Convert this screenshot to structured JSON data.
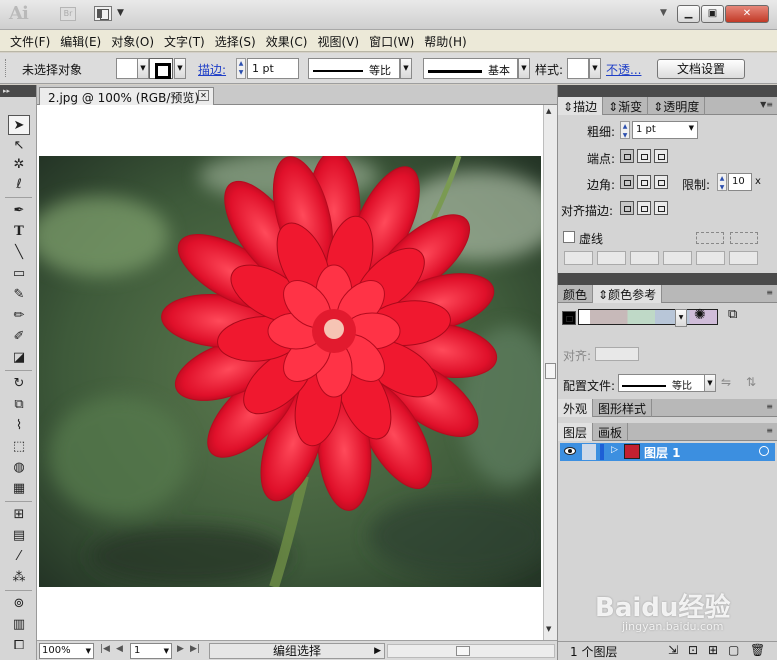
{
  "app": {
    "logo": "Ai",
    "bridge_label": "Br"
  },
  "menubar": [
    "文件(F)",
    "编辑(E)",
    "对象(O)",
    "文字(T)",
    "选择(S)",
    "效果(C)",
    "视图(V)",
    "窗口(W)",
    "帮助(H)"
  ],
  "controlbar": {
    "selection_status": "未选择对象",
    "stroke_label": "描边:",
    "stroke_weight": "1 pt",
    "stroke_profile": "等比",
    "brush": "基本",
    "style_label": "样式:",
    "opacity_link": "不透...",
    "doc_settings": "文档设置"
  },
  "document": {
    "tab_title": "2.jpg @ 100% (RGB/预览)",
    "zoom": "100%",
    "page": "1",
    "status": "编组选择"
  },
  "stroke_panel": {
    "tabs": [
      "描边",
      "渐变",
      "透明度"
    ],
    "weight_label": "粗细:",
    "weight_value": "1 pt",
    "cap_label": "端点:",
    "corner_label": "边角:",
    "limit_label": "限制:",
    "limit_value": "10",
    "limit_unit": "x",
    "align_label": "对齐描边:",
    "dashed_label": "虚线"
  },
  "color_panel": {
    "tabs": [
      "颜色",
      "颜色参考"
    ],
    "align_label": "对齐:",
    "profile_label": "配置文件:",
    "profile_value": "等比"
  },
  "appearance_panel": {
    "tabs": [
      "外观",
      "图形样式"
    ]
  },
  "layers_panel": {
    "tabs": [
      "图层",
      "画板"
    ],
    "layer_name": "图层 1",
    "footer": "1 个图层"
  },
  "watermark": {
    "main": "Baidu经验",
    "sub": "jingyan.baidu.com"
  },
  "colors": {
    "selection": "#3c8fe0",
    "link": "#1f3fc7",
    "close_button": "#c23a27"
  }
}
